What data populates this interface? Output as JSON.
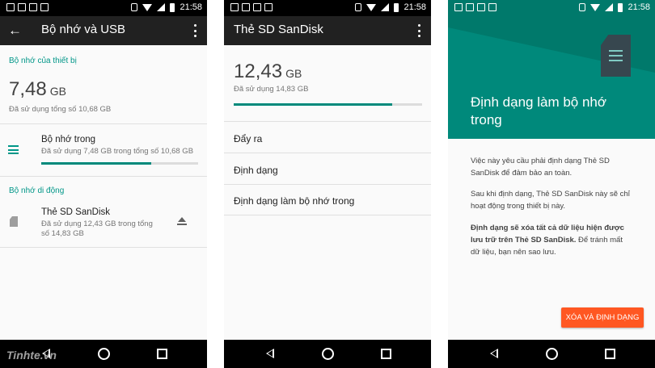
{
  "status": {
    "time": "21:58"
  },
  "screen1": {
    "title": "Bộ nhớ và USB",
    "device_section": "Bộ nhớ của thiết bị",
    "device_used": "7,48",
    "device_unit": "GB",
    "device_summary": "Đã sử dụng tổng số 10,68 GB",
    "internal": {
      "title": "Bộ nhớ trong",
      "subtitle": "Đã sử dụng 7,48 GB trong tổng số 10,68 GB",
      "progress": 0.7
    },
    "portable_section": "Bộ nhớ di động",
    "sd": {
      "title": "Thẻ SD SanDisk",
      "subtitle_1": "Đã sử dụng 12,43 GB trong tổng",
      "subtitle_2": "số 14,83 GB"
    }
  },
  "screen2": {
    "title": "Thẻ SD SanDisk",
    "used": "12,43",
    "unit": "GB",
    "summary": "Đã sử dụng 14,83 GB",
    "progress": 0.84,
    "menu": [
      "Đẩy ra",
      "Định dạng",
      "Định dạng làm bộ nhớ trong"
    ]
  },
  "screen3": {
    "title_1": "Định dạng làm bộ nhớ",
    "title_2": "trong",
    "para1_1": "Việc này yêu cầu phải định dạng Thẻ SD",
    "para1_2": "SanDisk để đảm bảo an toàn.",
    "para2_1": "Sau khi định dạng, Thẻ SD SanDisk này sẽ chỉ",
    "para2_2": "hoạt động trong thiết bị này.",
    "para3_bold_1": "Định dạng sẽ xóa tất cả dữ liệu hiện được",
    "para3_bold_2": "lưu trữ trên Thẻ SD SanDisk.",
    "para3_rest_1": " Để tránh mất",
    "para3_rest_2": "dữ liệu, bạn nên sao lưu.",
    "button": "XÓA VÀ ĐỊNH DẠNG"
  },
  "watermark": "Tinhte.vn",
  "colors": {
    "accent": "#009688",
    "button": "#ff5722",
    "appbar": "#212121",
    "header": "#00897b"
  }
}
